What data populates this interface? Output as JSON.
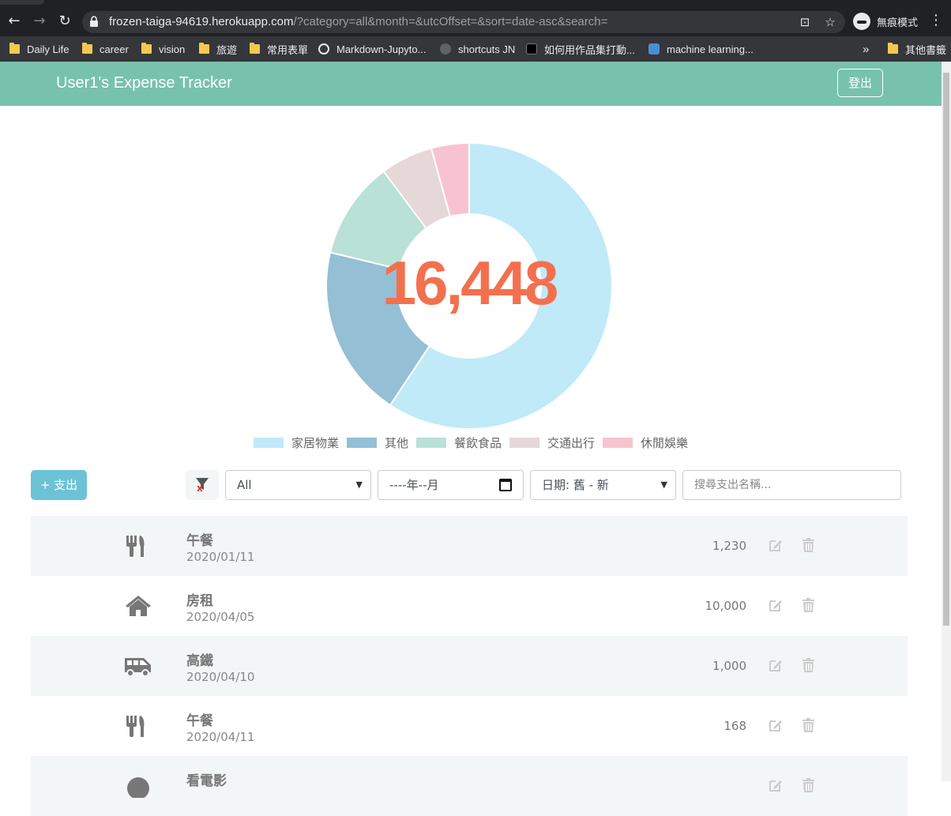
{
  "browser": {
    "url_host": "frozen-taiga-94619.herokuapp.com",
    "url_rest": "/?category=all&month=&utcOffset=&sort=date-asc&search=",
    "incognito_label": "無痕模式",
    "bookmarks": [
      {
        "label": "Daily Life",
        "icon": "folder-icon"
      },
      {
        "label": "career",
        "icon": "folder-icon"
      },
      {
        "label": "vision",
        "icon": "folder-icon"
      },
      {
        "label": "旅遊",
        "icon": "folder-icon"
      },
      {
        "label": "常用表單",
        "icon": "folder-icon"
      },
      {
        "label": "Markdown-Jupyto...",
        "icon": "globe-icon"
      },
      {
        "label": "shortcuts JN",
        "icon": "app-icon"
      },
      {
        "label": "如何用作品集打動...",
        "icon": "medium-icon"
      },
      {
        "label": "machine learning...",
        "icon": "app-icon"
      }
    ],
    "other_bookmarks": "其他書籤",
    "overflow": "»"
  },
  "app": {
    "brand": "User1's Expense Tracker",
    "logout": "登出",
    "total": "16,448"
  },
  "chart_data": {
    "type": "pie",
    "categories": [
      "家居物業",
      "其他",
      "餐飲食品",
      "交通出行",
      "休閒娛樂"
    ],
    "values": [
      10000,
      3281,
      1859,
      1000,
      720
    ],
    "colors": [
      "#c0eaf8",
      "#94bfd5",
      "#b9e1d5",
      "#e6d7d8",
      "#f8c3d0"
    ]
  },
  "controls": {
    "add_button": "+ 支出",
    "category_select": "All",
    "month_input": "----年--月",
    "sort_select": "日期: 舊 - 新",
    "search_placeholder": "搜尋支出名稱..."
  },
  "records": [
    {
      "name": "午餐",
      "date": "2020/01/11",
      "amount": "1,230",
      "icon": "utensils-icon"
    },
    {
      "name": "房租",
      "date": "2020/04/05",
      "amount": "10,000",
      "icon": "home-icon"
    },
    {
      "name": "高鐵",
      "date": "2020/04/10",
      "amount": "1,000",
      "icon": "shuttle-van-icon"
    },
    {
      "name": "午餐",
      "date": "2020/04/11",
      "amount": "168",
      "icon": "utensils-icon"
    },
    {
      "name": "看電影",
      "date": "",
      "amount": "",
      "icon": "movie-icon"
    }
  ]
}
